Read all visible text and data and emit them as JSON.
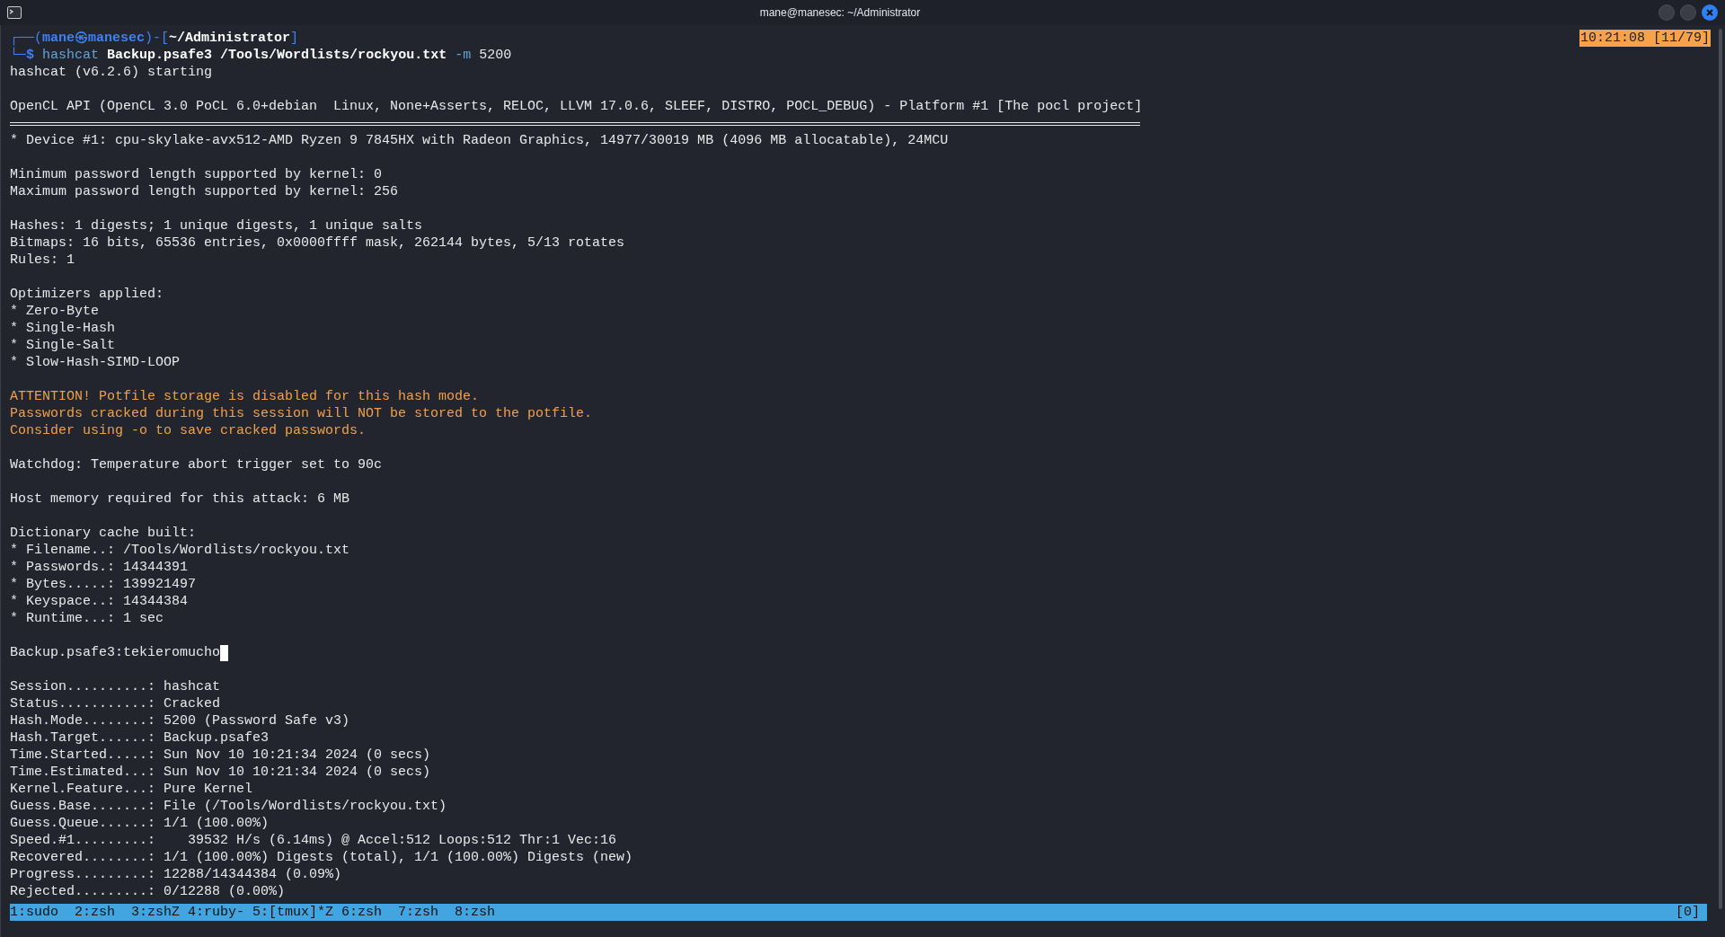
{
  "window": {
    "title": "mane@manesec: ~/Administrator"
  },
  "clock": "10:21:08 [11/79]",
  "prompt": {
    "open": "┌──(",
    "at": "㉿",
    "sep": ")-[",
    "close": "]",
    "corner": "└─",
    "symbol": "$",
    "user": "mane",
    "host": "manesec",
    "cwd": "~/Administrator",
    "command": "hashcat",
    "args": "Backup.psafe3 /Tools/Wordlists/rockyou.txt",
    "flag": "-m",
    "flag_value": "5200"
  },
  "lines": [
    {
      "kind": "output",
      "text": "hashcat (v6.2.6) starting"
    },
    {
      "kind": "blank"
    },
    {
      "kind": "output",
      "text": "OpenCL API (OpenCL 3.0 PoCL 6.0+debian  Linux, None+Asserts, RELOC, LLVM 17.0.6, SLEEF, DISTRO, POCL_DEBUG) - Platform #1 [The pocl project]"
    },
    {
      "kind": "rule"
    },
    {
      "kind": "output",
      "text": "* Device #1: cpu-skylake-avx512-AMD Ryzen 9 7845HX with Radeon Graphics, 14977/30019 MB (4096 MB allocatable), 24MCU"
    },
    {
      "kind": "blank"
    },
    {
      "kind": "output",
      "text": "Minimum password length supported by kernel: 0"
    },
    {
      "kind": "output",
      "text": "Maximum password length supported by kernel: 256"
    },
    {
      "kind": "blank"
    },
    {
      "kind": "output",
      "text": "Hashes: 1 digests; 1 unique digests, 1 unique salts"
    },
    {
      "kind": "output",
      "text": "Bitmaps: 16 bits, 65536 entries, 0x0000ffff mask, 262144 bytes, 5/13 rotates"
    },
    {
      "kind": "output",
      "text": "Rules: 1"
    },
    {
      "kind": "blank"
    },
    {
      "kind": "output",
      "text": "Optimizers applied:"
    },
    {
      "kind": "output",
      "text": "* Zero-Byte"
    },
    {
      "kind": "output",
      "text": "* Single-Hash"
    },
    {
      "kind": "output",
      "text": "* Single-Salt"
    },
    {
      "kind": "output",
      "text": "* Slow-Hash-SIMD-LOOP"
    },
    {
      "kind": "blank"
    },
    {
      "kind": "warning",
      "text": "ATTENTION! Potfile storage is disabled for this hash mode."
    },
    {
      "kind": "warning",
      "text": "Passwords cracked during this session will NOT be stored to the potfile."
    },
    {
      "kind": "warning",
      "text": "Consider using -o to save cracked passwords."
    },
    {
      "kind": "blank"
    },
    {
      "kind": "output",
      "text": "Watchdog: Temperature abort trigger set to 90c"
    },
    {
      "kind": "blank"
    },
    {
      "kind": "output",
      "text": "Host memory required for this attack: 6 MB"
    },
    {
      "kind": "blank"
    },
    {
      "kind": "output",
      "text": "Dictionary cache built:"
    },
    {
      "kind": "output",
      "text": "* Filename..: /Tools/Wordlists/rockyou.txt"
    },
    {
      "kind": "output",
      "text": "* Passwords.: 14344391"
    },
    {
      "kind": "output",
      "text": "* Bytes.....: 139921497"
    },
    {
      "kind": "output",
      "text": "* Keyspace..: 14344384"
    },
    {
      "kind": "output",
      "text": "* Runtime...: 1 sec"
    },
    {
      "kind": "blank"
    },
    {
      "kind": "output",
      "text": "Backup.psafe3:tekieromucho",
      "cursor": true
    },
    {
      "kind": "blank"
    },
    {
      "kind": "output",
      "text": "Session..........: hashcat"
    },
    {
      "kind": "output",
      "text": "Status...........: Cracked"
    },
    {
      "kind": "output",
      "text": "Hash.Mode........: 5200 (Password Safe v3)"
    },
    {
      "kind": "output",
      "text": "Hash.Target......: Backup.psafe3"
    },
    {
      "kind": "output",
      "text": "Time.Started.....: Sun Nov 10 10:21:34 2024 (0 secs)"
    },
    {
      "kind": "output",
      "text": "Time.Estimated...: Sun Nov 10 10:21:34 2024 (0 secs)"
    },
    {
      "kind": "output",
      "text": "Kernel.Feature...: Pure Kernel"
    },
    {
      "kind": "output",
      "text": "Guess.Base.......: File (/Tools/Wordlists/rockyou.txt)"
    },
    {
      "kind": "output",
      "text": "Guess.Queue......: 1/1 (100.00%)"
    },
    {
      "kind": "output",
      "text": "Speed.#1.........:    39532 H/s (6.14ms) @ Accel:512 Loops:512 Thr:1 Vec:16"
    },
    {
      "kind": "output",
      "text": "Recovered........: 1/1 (100.00%) Digests (total), 1/1 (100.00%) Digests (new)"
    },
    {
      "kind": "output",
      "text": "Progress.........: 12288/14344384 (0.09%)"
    },
    {
      "kind": "output",
      "text": "Rejected.........: 0/12288 (0.00%)"
    }
  ],
  "status_bar": {
    "windows": "1:sudo  2:zsh  3:zshZ 4:ruby- 5:[tmux]*Z 6:zsh  7:zsh  8:zsh",
    "pane": "[0]"
  }
}
